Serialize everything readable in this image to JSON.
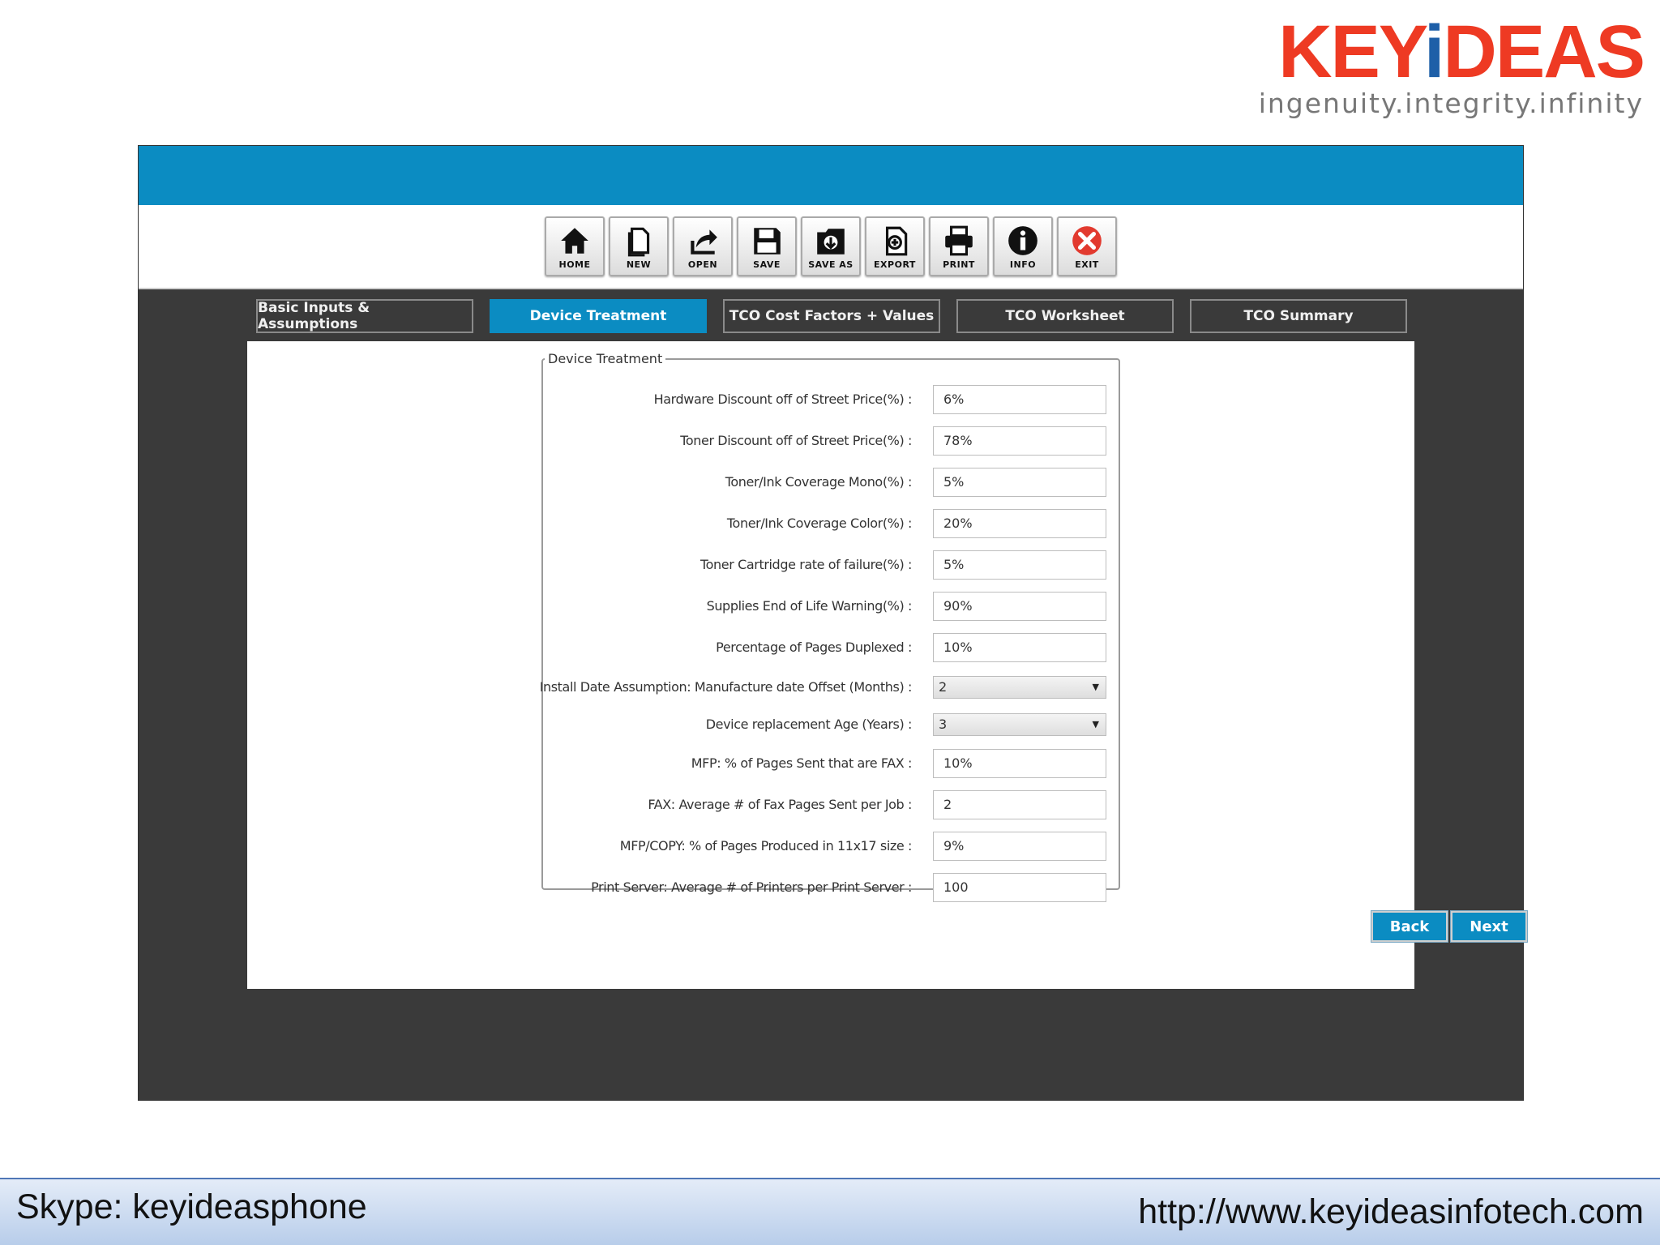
{
  "brand": {
    "logo_text": "KEYiDEAS",
    "logo_prefix": "KEY",
    "logo_i": "i",
    "logo_suffix": "DEAS",
    "tagline": "ingenuity.integrity.infinity",
    "colors": {
      "primary": "#ee3a23",
      "accent": "#1e5fa8"
    }
  },
  "toolbar": {
    "buttons": [
      {
        "label": "HOME",
        "icon": "home-icon"
      },
      {
        "label": "NEW",
        "icon": "new-document-icon"
      },
      {
        "label": "OPEN",
        "icon": "open-icon"
      },
      {
        "label": "SAVE",
        "icon": "save-icon"
      },
      {
        "label": "SAVE AS",
        "icon": "save-as-icon"
      },
      {
        "label": "EXPORT",
        "icon": "export-icon"
      },
      {
        "label": "PRINT",
        "icon": "print-icon"
      },
      {
        "label": "INFO",
        "icon": "info-icon"
      },
      {
        "label": "EXIT",
        "icon": "exit-icon"
      }
    ]
  },
  "tabs": [
    {
      "label": "Basic Inputs & Assumptions",
      "active": false
    },
    {
      "label": "Device Treatment",
      "active": true
    },
    {
      "label": "TCO Cost Factors + Values",
      "active": false
    },
    {
      "label": "TCO Worksheet",
      "active": false
    },
    {
      "label": "TCO Summary",
      "active": false
    }
  ],
  "form": {
    "legend": "Device Treatment",
    "fields": [
      {
        "label": "Hardware Discount off of Street Price(%) :",
        "value": "6%",
        "type": "text"
      },
      {
        "label": "Toner Discount off of Street Price(%) :",
        "value": "78%",
        "type": "text"
      },
      {
        "label": "Toner/Ink Coverage Mono(%) :",
        "value": "5%",
        "type": "text"
      },
      {
        "label": "Toner/Ink Coverage Color(%) :",
        "value": "20%",
        "type": "text"
      },
      {
        "label": "Toner Cartridge rate of failure(%) :",
        "value": "5%",
        "type": "text"
      },
      {
        "label": "Supplies End of Life Warning(%) :",
        "value": "90%",
        "type": "text"
      },
      {
        "label": "Percentage of Pages Duplexed :",
        "value": "10%",
        "type": "text"
      },
      {
        "label": "Install Date Assumption: Manufacture date Offset (Months) :",
        "value": "2",
        "type": "select"
      },
      {
        "label": "Device replacement Age (Years) :",
        "value": "3",
        "type": "select"
      },
      {
        "label": "MFP: % of Pages Sent that are FAX :",
        "value": "10%",
        "type": "text"
      },
      {
        "label": "FAX: Average # of Fax Pages Sent per Job :",
        "value": "2",
        "type": "text"
      },
      {
        "label": "MFP/COPY: % of Pages Produced in 11x17 size :",
        "value": "9%",
        "type": "text"
      },
      {
        "label": "Print Server: Average # of Printers per Print Server :",
        "value": "100",
        "type": "text"
      }
    ]
  },
  "nav": {
    "back_label": "Back",
    "next_label": "Next"
  },
  "footer": {
    "skype": "Skype: keyideasphone",
    "website": "http://www.keyideasinfotech.com"
  },
  "colors": {
    "app_blue": "#0b8cc2",
    "app_dark": "#3a3a3a"
  }
}
